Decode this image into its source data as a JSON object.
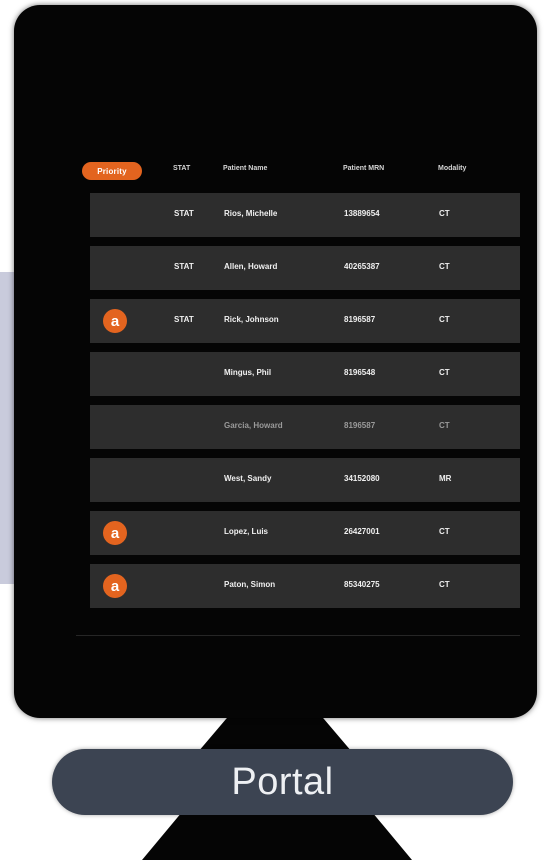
{
  "portal": {
    "label": "Portal"
  },
  "worklist": {
    "columns": {
      "priority": "Priority",
      "stat": "STAT",
      "patient_name": "Patient Name",
      "patient_mrn": "Patient MRN",
      "modality": "Modality"
    },
    "rows": [
      {
        "has_flag": false,
        "stat": "STAT",
        "name": "Rios, Michelle",
        "mrn": "13889654",
        "modality": "CT",
        "dim": false
      },
      {
        "has_flag": false,
        "stat": "STAT",
        "name": "Allen, Howard",
        "mrn": "40265387",
        "modality": "CT",
        "dim": false
      },
      {
        "has_flag": true,
        "flag_letter": "a",
        "stat": "STAT",
        "name": "Rick, Johnson",
        "mrn": "8196587",
        "modality": "CT",
        "dim": false
      },
      {
        "has_flag": false,
        "stat": "",
        "name": "Mingus, Phil",
        "mrn": "8196548",
        "modality": "CT",
        "dim": false
      },
      {
        "has_flag": false,
        "stat": "",
        "name": "Garcia, Howard",
        "mrn": "8196587",
        "modality": "CT",
        "dim": true
      },
      {
        "has_flag": false,
        "stat": "",
        "name": "West, Sandy",
        "mrn": "34152080",
        "modality": "MR",
        "dim": false
      },
      {
        "has_flag": true,
        "flag_letter": "a",
        "stat": "",
        "name": "Lopez, Luis",
        "mrn": "26427001",
        "modality": "CT",
        "dim": false
      },
      {
        "has_flag": true,
        "flag_letter": "a",
        "stat": "",
        "name": "Paton, Simon",
        "mrn": "85340275",
        "modality": "CT",
        "dim": false
      }
    ]
  },
  "colors": {
    "accent": "#e3641f",
    "row_bg": "#2d2d2d",
    "screen_bg": "#050505",
    "portal_bg": "#3c4452"
  }
}
